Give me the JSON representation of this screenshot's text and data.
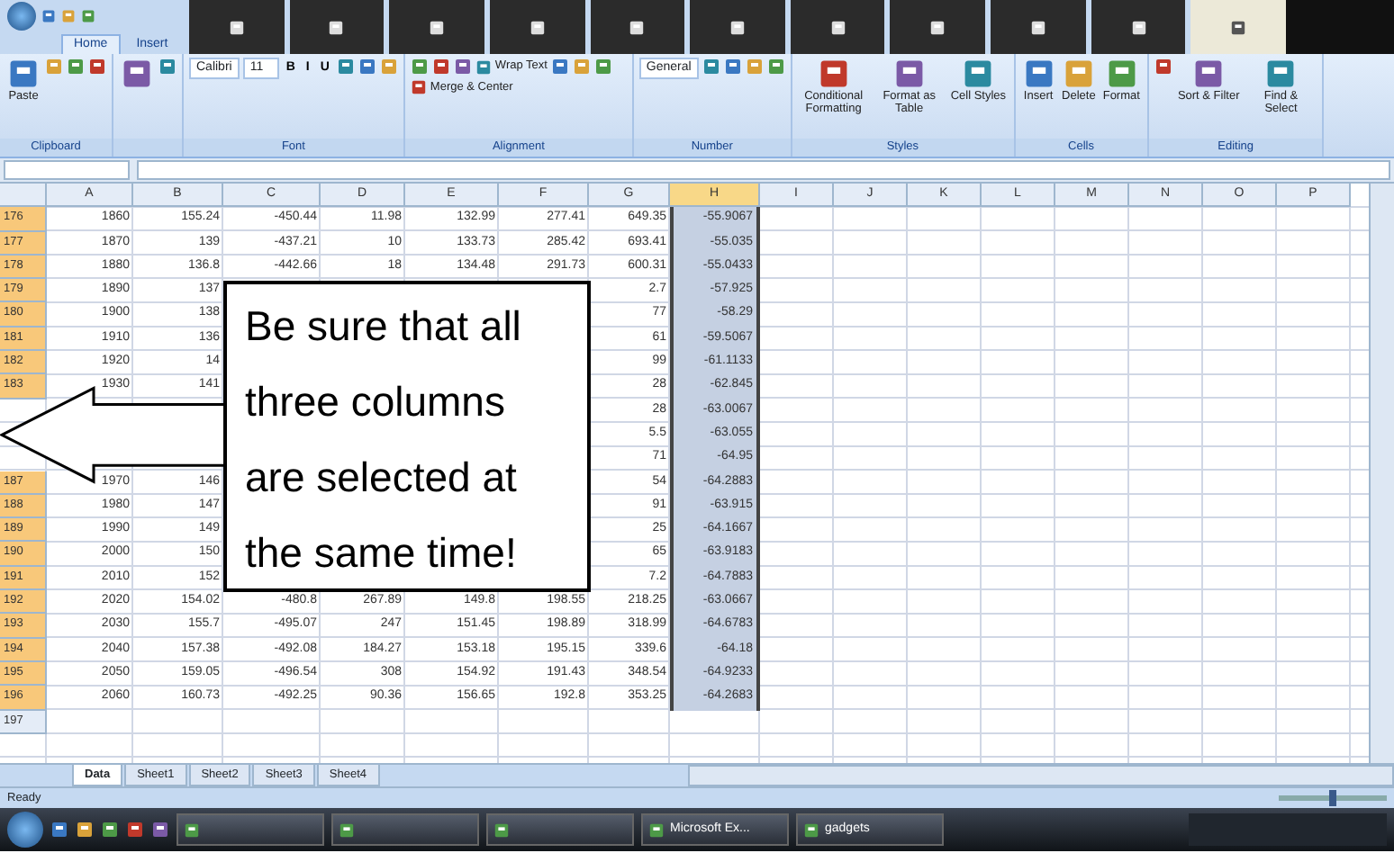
{
  "ribbon": {
    "tabs": [
      {
        "label": "Home",
        "selected": true
      },
      {
        "label": "Insert",
        "selected": false
      }
    ],
    "groups": [
      {
        "label": "Clipboard",
        "commands": [
          {
            "kind": "large",
            "label": "Paste"
          },
          {
            "kind": "icon"
          },
          {
            "kind": "icon"
          },
          {
            "kind": "icon"
          }
        ]
      },
      {
        "commands": [
          {
            "kind": "large"
          },
          {
            "kind": "icon"
          }
        ]
      },
      {
        "label": "Font",
        "commands": [
          {
            "kind": "field",
            "label": "Calibri"
          },
          {
            "kind": "field",
            "label": "11"
          },
          {
            "kind": "glyph",
            "label": "B"
          },
          {
            "kind": "glyph",
            "label": "I"
          },
          {
            "kind": "glyph",
            "label": "U"
          },
          {
            "kind": "icon"
          },
          {
            "kind": "icon"
          },
          {
            "kind": "icon"
          }
        ]
      },
      {
        "label": "Alignment",
        "commands": [
          {
            "kind": "icon"
          },
          {
            "kind": "icon"
          },
          {
            "kind": "icon"
          },
          {
            "kind": "small",
            "label": "Wrap Text"
          },
          {
            "kind": "icon"
          },
          {
            "kind": "icon"
          },
          {
            "kind": "icon"
          },
          {
            "kind": "small",
            "label": "Merge & Center"
          }
        ]
      },
      {
        "label": "Number",
        "commands": [
          {
            "kind": "field",
            "label": "General"
          },
          {
            "kind": "icon"
          },
          {
            "kind": "icon"
          },
          {
            "kind": "icon"
          },
          {
            "kind": "icon"
          }
        ]
      },
      {
        "label": "Styles",
        "commands": [
          {
            "kind": "large",
            "label": "Conditional Formatting"
          },
          {
            "kind": "large",
            "label": "Format as Table"
          },
          {
            "kind": "large",
            "label": "Cell Styles"
          }
        ]
      },
      {
        "label": "Cells",
        "commands": [
          {
            "kind": "large",
            "label": "Insert"
          },
          {
            "kind": "large",
            "label": "Delete"
          },
          {
            "kind": "large",
            "label": "Format"
          }
        ]
      },
      {
        "label": "Editing",
        "commands": [
          {
            "kind": "icon"
          },
          {
            "kind": "large",
            "label": "Sort & Filter"
          },
          {
            "kind": "large",
            "label": "Find & Select"
          }
        ]
      }
    ]
  },
  "sheet": {
    "columns": [
      {
        "label": "A",
        "selected": false
      },
      {
        "label": "B",
        "selected": false
      },
      {
        "label": "C",
        "selected": false
      },
      {
        "label": "D",
        "selected": false
      },
      {
        "label": "E",
        "selected": false
      },
      {
        "label": "F",
        "selected": false
      },
      {
        "label": "G",
        "selected": false
      },
      {
        "label": "H",
        "selected": true
      },
      {
        "label": "I",
        "selected": false
      },
      {
        "label": "J",
        "selected": false
      },
      {
        "label": "K",
        "selected": false
      },
      {
        "label": "L",
        "selected": false
      },
      {
        "label": "M",
        "selected": false
      },
      {
        "label": "N",
        "selected": false
      },
      {
        "label": "O",
        "selected": false
      },
      {
        "label": "P",
        "selected": false
      }
    ],
    "rows": [
      {
        "number": "176",
        "selected": true,
        "cells": [
          "1860",
          "155.24",
          "-450.44",
          "11.98",
          "132.99",
          "277.41",
          "649.35",
          "-55.9067"
        ]
      },
      {
        "number": "177",
        "selected": true,
        "cells": [
          "1870",
          "139",
          "-437.21",
          "10",
          "133.73",
          "285.42",
          "693.41",
          "-55.035"
        ]
      },
      {
        "number": "178",
        "selected": true,
        "cells": [
          "1880",
          "136.8",
          "-442.66",
          "18",
          "134.48",
          "291.73",
          "600.31",
          "-55.0433"
        ]
      },
      {
        "number": "179",
        "selected": true,
        "cells": [
          "1890",
          "137",
          null,
          null,
          null,
          null,
          "2.7",
          "-57.925"
        ]
      },
      {
        "number": "180",
        "selected": true,
        "cells": [
          "1900",
          "138",
          null,
          null,
          null,
          null,
          "77",
          "-58.29"
        ]
      },
      {
        "number": "181",
        "selected": true,
        "cells": [
          "1910",
          "136",
          null,
          null,
          null,
          null,
          "61",
          "-59.5067"
        ]
      },
      {
        "number": "182",
        "selected": true,
        "cells": [
          "1920",
          "14",
          null,
          null,
          null,
          null,
          "99",
          "-61.1133"
        ]
      },
      {
        "number": "183",
        "selected": true,
        "cells": [
          "1930",
          "141",
          null,
          null,
          null,
          null,
          "28",
          "-62.845"
        ]
      },
      {
        "cells": [
          null,
          null,
          null,
          null,
          null,
          null,
          "28",
          "-63.0067"
        ]
      },
      {
        "cells": [
          null,
          null,
          null,
          null,
          null,
          null,
          "5.5",
          "-63.055"
        ]
      },
      {
        "cells": [
          null,
          null,
          null,
          null,
          null,
          null,
          "71",
          "-64.95"
        ]
      },
      {
        "number": "187",
        "selected": true,
        "cells": [
          "1970",
          "146",
          null,
          null,
          null,
          null,
          "54",
          "-64.2883"
        ]
      },
      {
        "number": "188",
        "selected": true,
        "cells": [
          "1980",
          "147",
          null,
          null,
          null,
          null,
          "91",
          "-63.915"
        ]
      },
      {
        "number": "189",
        "selected": true,
        "cells": [
          "1990",
          "149",
          null,
          null,
          null,
          null,
          "25",
          "-64.1667"
        ]
      },
      {
        "number": "190",
        "selected": true,
        "cells": [
          "2000",
          "150",
          null,
          null,
          null,
          null,
          "65",
          "-63.9183"
        ]
      },
      {
        "number": "191",
        "selected": true,
        "cells": [
          "2010",
          "152",
          null,
          null,
          null,
          null,
          "7.2",
          "-64.7883"
        ]
      },
      {
        "number": "192",
        "selected": true,
        "cells": [
          "2020",
          "154.02",
          "-480.8",
          "267.89",
          "149.8",
          "198.55",
          "218.25",
          "-63.0667"
        ]
      },
      {
        "number": "193",
        "selected": true,
        "cells": [
          "2030",
          "155.7",
          "-495.07",
          "247",
          "151.45",
          "198.89",
          "318.99",
          "-64.6783"
        ]
      },
      {
        "number": "194",
        "selected": true,
        "cells": [
          "2040",
          "157.38",
          "-492.08",
          "184.27",
          "153.18",
          "195.15",
          "339.6",
          "-64.18"
        ]
      },
      {
        "number": "195",
        "selected": true,
        "cells": [
          "2050",
          "159.05",
          "-496.54",
          "308",
          "154.92",
          "191.43",
          "348.54",
          "-64.9233"
        ]
      },
      {
        "number": "196",
        "selected": true,
        "cells": [
          "2060",
          "160.73",
          "-492.25",
          "90.36",
          "156.65",
          "192.8",
          "353.25",
          "-64.2683"
        ]
      },
      {
        "number": "197",
        "selected": false,
        "cells": []
      }
    ]
  },
  "callout": {
    "text": "Be sure that all three columns are selected at the same time!"
  },
  "sheet_tabs": [
    {
      "label": "Data",
      "selected": true
    },
    {
      "label": "Sheet1",
      "selected": false
    },
    {
      "label": "Sheet2",
      "selected": false
    },
    {
      "label": "Sheet3",
      "selected": false
    },
    {
      "label": "Sheet4",
      "selected": false
    }
  ],
  "status_bar": {
    "text": "Ready",
    "zoom": {
      "level": 0.5
    }
  },
  "taskbar": {
    "buttons": [
      {
        "kind": "window"
      },
      {
        "kind": "window"
      },
      {
        "kind": "window"
      },
      {
        "kind": "window",
        "label": "Microsoft Ex..."
      },
      {
        "kind": "window",
        "label": "gadgets"
      }
    ]
  }
}
